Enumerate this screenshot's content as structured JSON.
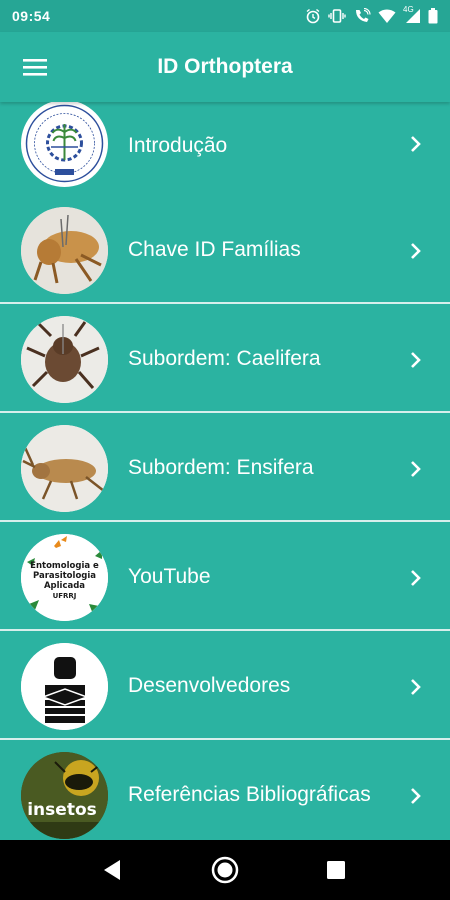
{
  "status_bar": {
    "time": "09:54",
    "network_label": "4G"
  },
  "app_bar": {
    "title": "ID Orthoptera"
  },
  "menu": {
    "items": [
      {
        "label": "Introdução",
        "icon": "ufrrj-logo"
      },
      {
        "label": "Chave ID Famílias",
        "icon": "grasshopper-photo"
      },
      {
        "label": "Subordem: Caelifera",
        "icon": "grasshopper-photo"
      },
      {
        "label": "Subordem: Ensifera",
        "icon": "cricket-photo"
      },
      {
        "label": "YouTube",
        "icon": "entomologia-logo",
        "logo_text": [
          "Entomologia e",
          "Parasitologia",
          "Aplicada",
          "UFRRJ"
        ]
      },
      {
        "label": "Desenvolvedores",
        "icon": "developer-icon"
      },
      {
        "label": "Referências Bibliográficas",
        "icon": "insetos-book-cover",
        "logo_text": "insetos"
      }
    ]
  },
  "colors": {
    "primary": "#2bb3a1",
    "status_bar": "#26a695",
    "divider": "#d6efec"
  }
}
